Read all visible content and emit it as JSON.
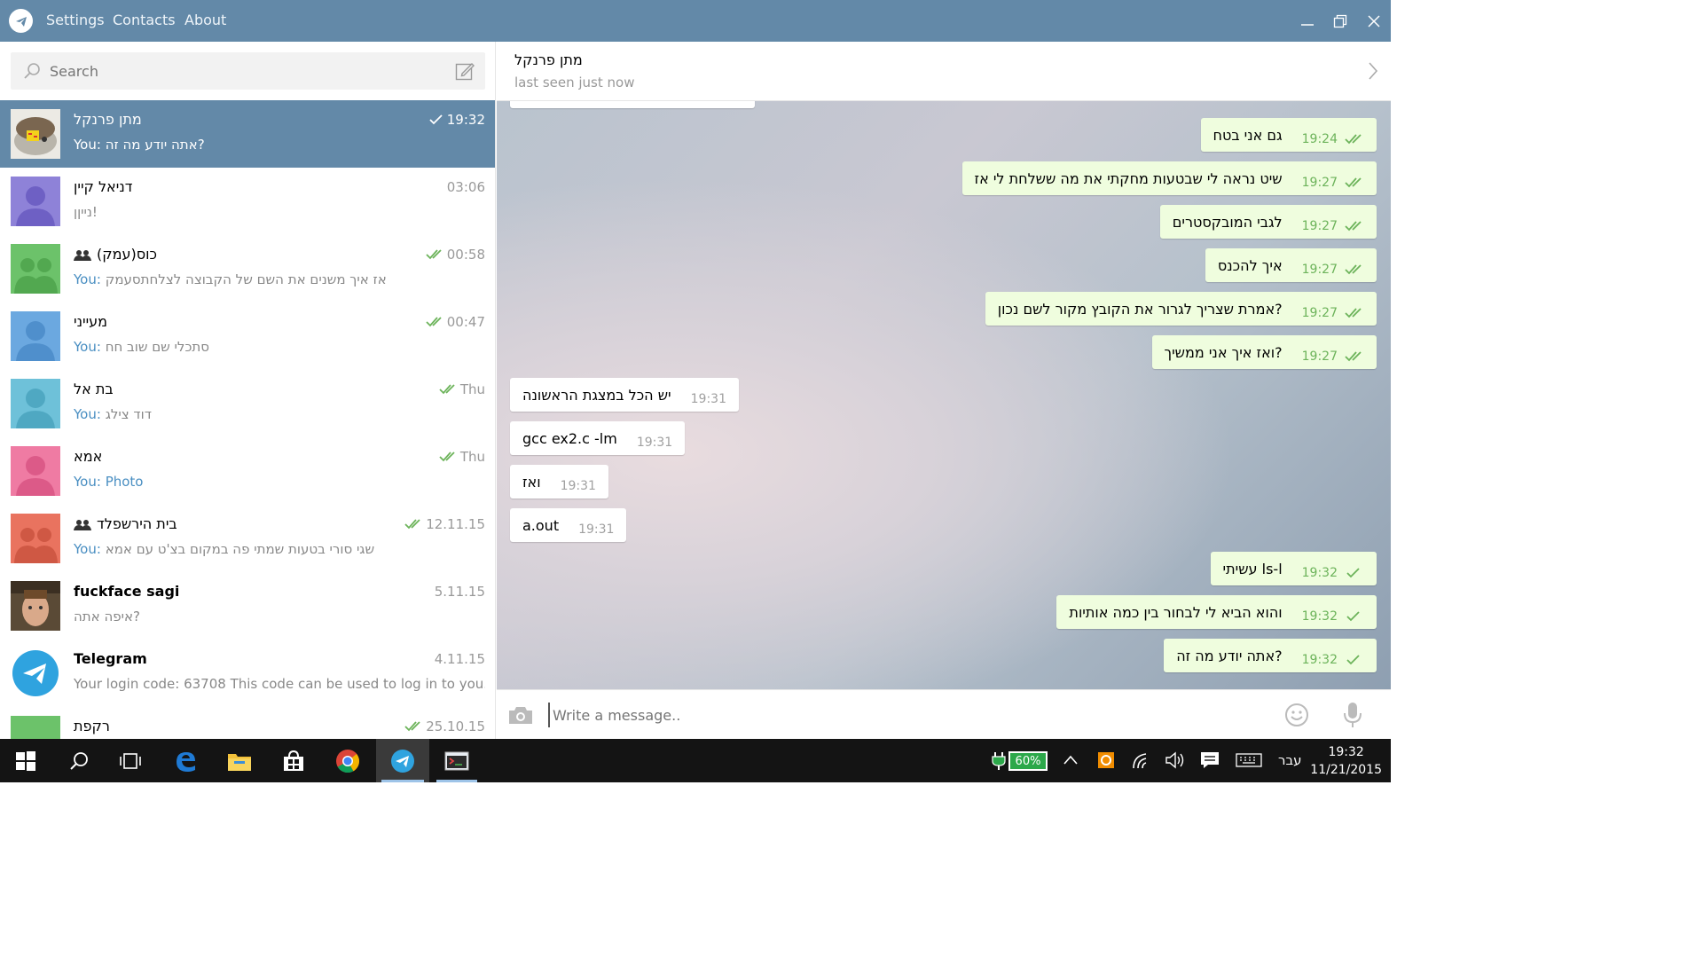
{
  "titlebar": {
    "menu": [
      "Settings",
      "Contacts",
      "About"
    ]
  },
  "search": {
    "placeholder": "Search"
  },
  "dialogs": [
    {
      "name": "מתן פרנקל",
      "time": "19:32",
      "you": "You: ",
      "text": "אתה יודע מה זה?",
      "checks": 1,
      "avatar": "sticker",
      "active": true
    },
    {
      "name": "דניאל קיין",
      "time": "03:06",
      "you": "",
      "text": "נייןן!",
      "checks": 0,
      "avatar": "#8e82d8"
    },
    {
      "name": "כוס(עמק)",
      "time": "00:58",
      "you": "You: ",
      "text": "אז איך משנים את השם של הקבוצה לצלחתסעמק",
      "checks": 2,
      "avatar": "#6cc26a",
      "group": true
    },
    {
      "name": "מעייני",
      "time": "00:47",
      "you": "You: ",
      "text": "סתכלי שם שוב חח",
      "checks": 2,
      "avatar": "#6ba8e0"
    },
    {
      "name": "בת אל",
      "time": "Thu",
      "you": "You: ",
      "text": "דוד צילג",
      "checks": 2,
      "avatar": "#6ec1d9"
    },
    {
      "name": "אמא",
      "time": "Thu",
      "you": "You: ",
      "text": "Photo",
      "photo": true,
      "checks": 2,
      "avatar": "#ef7ba3"
    },
    {
      "name": "בית הירשפלד",
      "time": "12.11.15",
      "you": "You: ",
      "text": "שגי סורי בטעות שמתי פה במקום בצ'ט עם אמא",
      "checks": 2,
      "avatar": "#e9735f",
      "group": true
    },
    {
      "name": "fuckface sagi",
      "time": "5.11.15",
      "you": "",
      "text": "איפה אתה?",
      "checks": 0,
      "avatar": "photo",
      "bold": true
    },
    {
      "name": "Telegram",
      "time": "4.11.15",
      "you": "",
      "text": "Your login code: 63708  This code can be used to log in to you...",
      "checks": 0,
      "avatar": "telegram",
      "bold": true
    },
    {
      "name": "רקפת",
      "time": "25.10.15",
      "you": "",
      "text": "",
      "checks": 2,
      "avatar": "#6cc26a"
    }
  ],
  "chat": {
    "peer_name": "מתן פרנקל",
    "peer_status": "last seen just now",
    "messages": [
      {
        "dir": "out",
        "text": "גם אני בטח",
        "time": "19:24",
        "checks": 2
      },
      {
        "dir": "out",
        "text": "שיט נראה לי שבטעות מחקתי את מה ששלחת לי אז",
        "time": "19:27",
        "checks": 2
      },
      {
        "dir": "out",
        "text": "לגבי המובקסטרים",
        "time": "19:27",
        "checks": 2
      },
      {
        "dir": "out",
        "text": "איך להכנס",
        "time": "19:27",
        "checks": 2
      },
      {
        "dir": "out",
        "text": "אמרת שצריך לגרור את הקובץ מקור לשם נכון?",
        "time": "19:27",
        "checks": 2
      },
      {
        "dir": "out",
        "text": "ואז איך אני ממשיך?",
        "time": "19:27",
        "checks": 2
      },
      {
        "dir": "in",
        "text": "יש הכל במצגת הראשונה",
        "time": "19:31"
      },
      {
        "dir": "in",
        "text": "gcc ex2.c -lm",
        "time": "19:31"
      },
      {
        "dir": "in",
        "text": "ואז",
        "time": "19:31"
      },
      {
        "dir": "in",
        "text": "a.out",
        "time": "19:31"
      },
      {
        "dir": "out",
        "text": "עשיתי ls-l",
        "time": "19:32",
        "checks": 1
      },
      {
        "dir": "out",
        "text": "והוא הביא לי לבחור בין כמה אותיות",
        "time": "19:32",
        "checks": 1
      },
      {
        "dir": "out",
        "text": "אתה יודע מה זה?",
        "time": "19:32",
        "checks": 1
      }
    ]
  },
  "composer": {
    "placeholder": "Write a message.."
  },
  "taskbar": {
    "battery": "60%",
    "lang": "עבר",
    "time": "19:32",
    "date": "11/21/2015"
  },
  "colors": {
    "titlebar": "#6389a8",
    "accent": "#4a8fc2",
    "out_bubble": "#effdde",
    "check": "#6cb35a"
  }
}
